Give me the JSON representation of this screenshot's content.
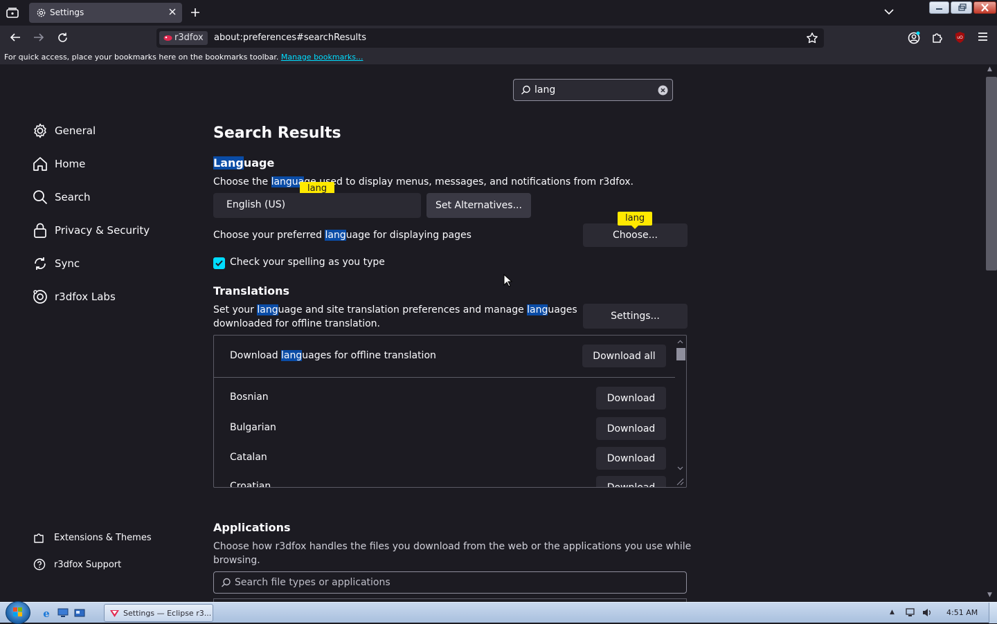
{
  "browser": {
    "tab": {
      "title": "Settings"
    },
    "identity_label": "r3dfox",
    "url": "about:preferences#searchResults",
    "bookmarks_bar": {
      "text": "For quick access, place your bookmarks here on the bookmarks toolbar.",
      "link": "Manage bookmarks..."
    }
  },
  "search": {
    "value": "lang"
  },
  "sidebar": {
    "items": [
      {
        "label": "General",
        "icon": "gear-icon"
      },
      {
        "label": "Home",
        "icon": "home-icon"
      },
      {
        "label": "Search",
        "icon": "search-icon"
      },
      {
        "label": "Privacy & Security",
        "icon": "lock-icon"
      },
      {
        "label": "Sync",
        "icon": "sync-icon"
      },
      {
        "label": "r3dfox Labs",
        "icon": "labs-icon"
      }
    ],
    "footer": [
      {
        "label": "Extensions & Themes",
        "icon": "puzzle-icon"
      },
      {
        "label": "r3dfox Support",
        "icon": "help-icon"
      }
    ]
  },
  "main": {
    "title": "Search Results",
    "language": {
      "heading_hl": "Lang",
      "heading_rest": "uage",
      "desc_pre": "Choose the ",
      "desc_hl": "langua",
      "desc_mid": "ge used",
      "desc_post": " to display menus, messages, and notifications from r3dfox.",
      "selected": "English (US)",
      "set_alternatives": "Set Alternatives...",
      "preferred_pre": "Choose your preferred ",
      "preferred_hl": "lang",
      "preferred_post": "uage for displaying pages",
      "choose_button": "Choose...",
      "spell_check": "Check your spelling as you type",
      "tooltip": "lang"
    },
    "translations": {
      "heading": "Translations",
      "desc_a": "Set your ",
      "desc_hl1": "lang",
      "desc_b": "uage and site translation preferences and manage ",
      "desc_hl2": "lang",
      "desc_c": "uages",
      "desc_line2": "downloaded for offline translation.",
      "settings_button": "Settings...",
      "list_header_pre": "Download ",
      "list_header_hl": "lang",
      "list_header_post": "uages for offline translation",
      "download_all": "Download all",
      "languages": [
        {
          "name": "Bosnian",
          "button": "Download"
        },
        {
          "name": "Bulgarian",
          "button": "Download"
        },
        {
          "name": "Catalan",
          "button": "Download"
        },
        {
          "name": "Croatian",
          "button": "Download"
        }
      ]
    },
    "applications": {
      "heading": "Applications",
      "desc_line1": "Choose how r3dfox handles the files you download from the web or the applications you use while",
      "desc_line2": "browsing.",
      "search_placeholder": "Search file types or applications"
    }
  },
  "taskbar": {
    "task_label": "Settings — Eclipse r3...",
    "clock": "4:51 AM"
  },
  "colors": {
    "background": "#1c1b22",
    "toolbar": "#2b2a33",
    "highlight": "#0a4ca6",
    "accent": "#00ddff",
    "tooltip": "#ffe900"
  }
}
